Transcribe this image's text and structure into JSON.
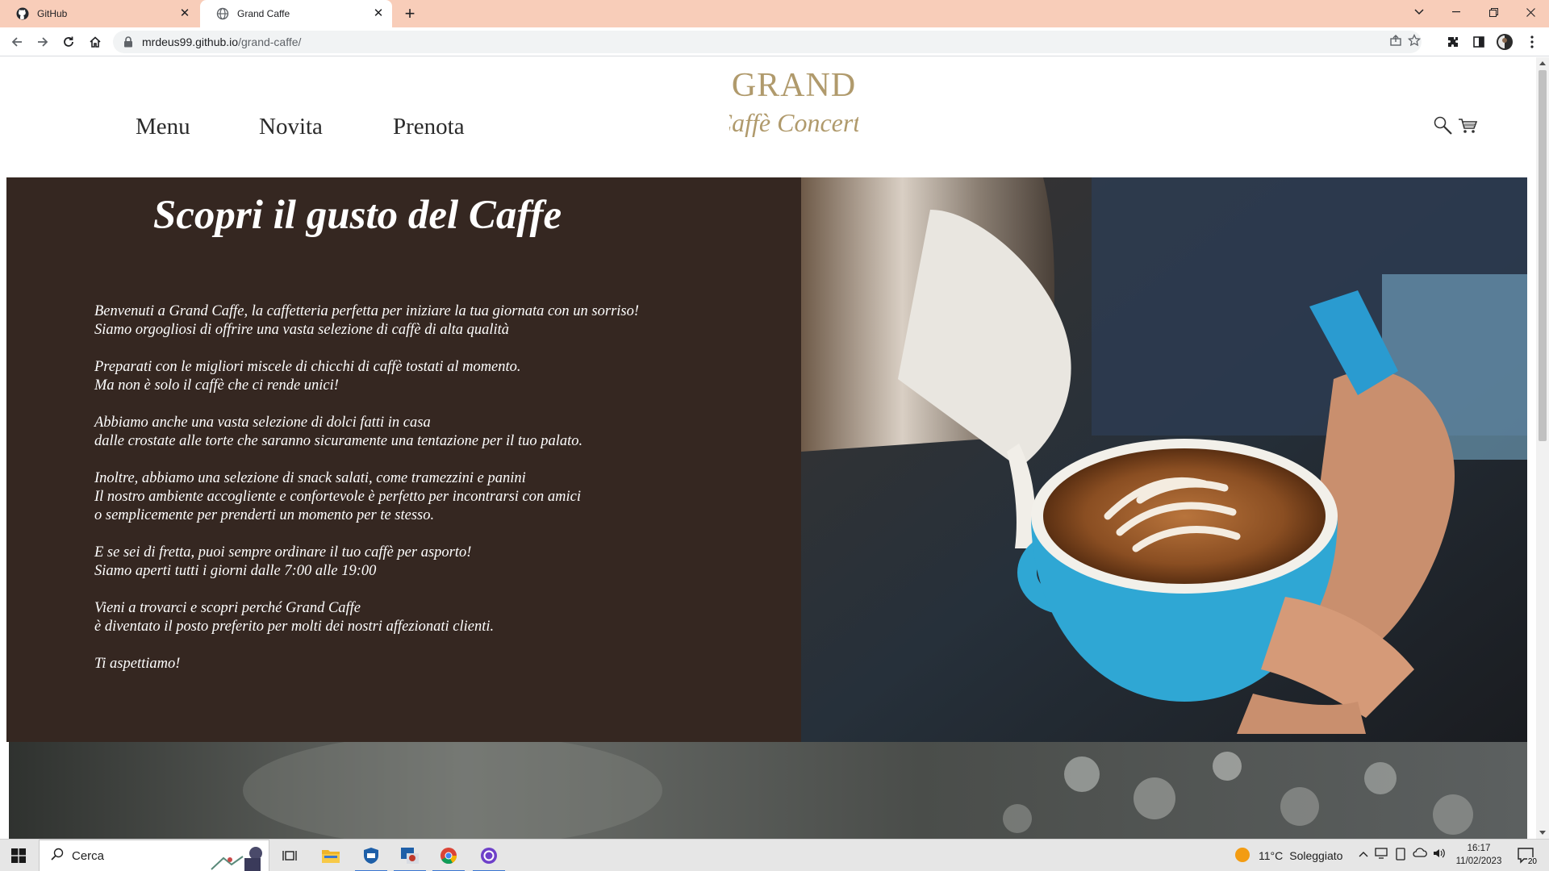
{
  "browser": {
    "tabs": [
      {
        "title": "GitHub",
        "icon": "github-icon"
      },
      {
        "title": "Grand Caffe",
        "icon": "globe-icon",
        "active": true
      }
    ],
    "new_tab": "+",
    "close_glyph": "✕",
    "url_host": "mrdeus99.github.io",
    "url_path": "/grand-caffe/"
  },
  "site": {
    "nav": [
      "Menu",
      "Novita",
      "Prenota"
    ],
    "logo_line1": "GRAND",
    "logo_line2": "Caffè Concerto",
    "hero_title": "Scopri il gusto del Caffe",
    "hero_paragraphs": [
      [
        "Benvenuti a Grand Caffe, la caffetteria perfetta per iniziare la tua giornata con un sorriso!",
        "Siamo orgogliosi di offrire una vasta selezione di caffè di alta qualità"
      ],
      [
        "Preparati con le migliori miscele di chicchi di caffè tostati al momento.",
        "Ma non è solo il caffè che ci rende unici!"
      ],
      [
        "Abbiamo anche una vasta selezione di dolci fatti in casa",
        "dalle crostate alle torte che saranno sicuramente una tentazione per il tuo palato."
      ],
      [
        "Inoltre, abbiamo una selezione di snack salati, come tramezzini e panini",
        "Il nostro ambiente accogliente e confortevole è perfetto per incontrarsi con amici",
        "o semplicemente per prenderti un momento per te stesso."
      ],
      [
        "E se sei di fretta, puoi sempre ordinare il tuo caffè per asporto!",
        "Siamo aperti tutti i giorni dalle 7:00 alle 19:00"
      ],
      [
        "Vieni a trovarci e scopri perché Grand Caffe",
        "è diventato il posto preferito per molti dei nostri affezionati clienti."
      ],
      [
        "Ti aspettiamo!"
      ]
    ],
    "colors": {
      "hero_bg": "#352721",
      "logo_gold": "#b09a6c",
      "cup_blue": "#2fa7d4"
    }
  },
  "taskbar": {
    "search_placeholder": "Cerca",
    "weather_temp": "11°C",
    "weather_desc": "Soleggiato",
    "time": "16:17",
    "date": "11/02/2023",
    "notification_count": "20"
  }
}
